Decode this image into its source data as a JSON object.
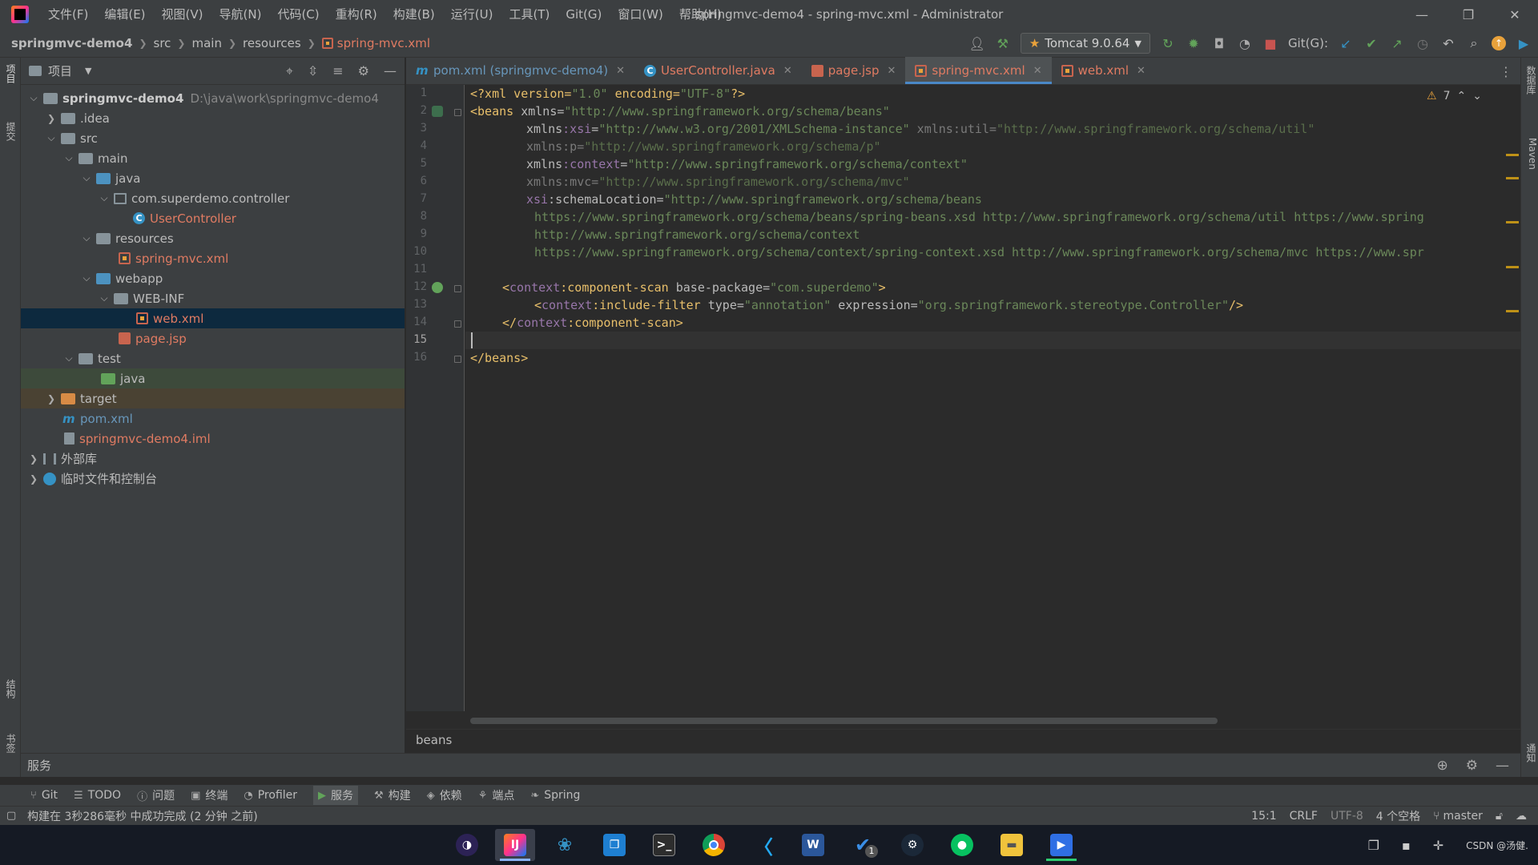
{
  "window": {
    "title": "springmvc-demo4 - spring-mvc.xml - Administrator",
    "menu": [
      "文件(F)",
      "编辑(E)",
      "视图(V)",
      "导航(N)",
      "代码(C)",
      "重构(R)",
      "构建(B)",
      "运行(U)",
      "工具(T)",
      "Git(G)",
      "窗口(W)",
      "帮助(H)"
    ]
  },
  "breadcrumbs": [
    "springmvc-demo4",
    "src",
    "main",
    "resources",
    "spring-mvc.xml"
  ],
  "toolbar": {
    "run_config": "Tomcat 9.0.64",
    "git_label": "Git(G):"
  },
  "left_strip": {
    "top_tab": "项目",
    "commit_tab": "提交",
    "structure_tab": "结构",
    "bookmarks_tab": "书签"
  },
  "right_strip": {
    "db_tab": "数据库",
    "maven_tab": "Maven",
    "notify_tab": "通知"
  },
  "project_panel": {
    "title": "项目",
    "tree": [
      {
        "label": "springmvc-demo4",
        "path": "D:\\java\\work\\springmvc-demo4"
      },
      {
        "label": ".idea"
      },
      {
        "label": "src"
      },
      {
        "label": "main"
      },
      {
        "label": "java"
      },
      {
        "label": "com.superdemo.controller"
      },
      {
        "label": "UserController"
      },
      {
        "label": "resources"
      },
      {
        "label": "spring-mvc.xml"
      },
      {
        "label": "webapp"
      },
      {
        "label": "WEB-INF"
      },
      {
        "label": "web.xml"
      },
      {
        "label": "page.jsp"
      },
      {
        "label": "test"
      },
      {
        "label": "java"
      },
      {
        "label": "target"
      },
      {
        "label": "pom.xml"
      },
      {
        "label": "springmvc-demo4.iml"
      },
      {
        "label": "外部库"
      },
      {
        "label": "临时文件和控制台"
      }
    ]
  },
  "tabs": [
    {
      "label": "pom.xml (springmvc-demo4)"
    },
    {
      "label": "UserController.java"
    },
    {
      "label": "page.jsp"
    },
    {
      "label": "spring-mvc.xml"
    },
    {
      "label": "web.xml"
    }
  ],
  "editor": {
    "warnings": "7",
    "line_numbers": [
      "1",
      "2",
      "3",
      "4",
      "5",
      "6",
      "7",
      "8",
      "9",
      "10",
      "11",
      "12",
      "13",
      "14",
      "15",
      "16"
    ],
    "breadcrumb": "beans"
  },
  "code": {
    "l1": {
      "a": "<?xml version=",
      "b": "\"1.0\"",
      "c": " encoding=",
      "d": "\"UTF-8\"",
      "e": "?>"
    },
    "l2": {
      "a": "<beans ",
      "b": "xmlns",
      "c": "=",
      "d": "\"http://www.springframework.org/schema/beans\""
    },
    "l3": {
      "a": "xmlns",
      "b": ":xsi",
      "c": "=",
      "d": "\"http://www.w3.org/2001/XMLSchema-instance\"",
      "e": " xmlns:util=",
      "f": "\"http://www.springframework.org/schema/util\""
    },
    "l4": {
      "a": "xmlns:p=",
      "b": "\"http://www.springframework.org/schema/p\""
    },
    "l5": {
      "a": "xmlns",
      "b": ":context",
      "c": "=",
      "d": "\"http://www.springframework.org/schema/context\""
    },
    "l6": {
      "a": "xmlns:mvc=",
      "b": "\"http://www.springframework.org/schema/mvc\""
    },
    "l7": {
      "a": "xsi",
      "b": ":schemaLocation=",
      "c": "\"http://www.springframework.org/schema/beans"
    },
    "l8": {
      "a": "https://www.springframework.org/schema/beans/spring-beans.xsd http://www.springframework.org/schema/util https://www.spring"
    },
    "l9": {
      "a": "http://www.springframework.org/schema/context"
    },
    "l10": {
      "a": "https://www.springframework.org/schema/context/spring-context.xsd http://www.springframework.org/schema/mvc https://www.spr"
    },
    "l12": {
      "a": "<",
      "b": "context",
      "c": ":component-scan ",
      "d": "base-package=",
      "e": "\"com.superdemo\"",
      "f": ">"
    },
    "l13": {
      "a": "<",
      "b": "context",
      "c": ":include-filter ",
      "d": "type=",
      "e": "\"annotation\"",
      "f": " expression=",
      "g": "\"org.springframework.stereotype.Controller\"",
      "h": "/>"
    },
    "l14": {
      "a": "</",
      "b": "context",
      "c": ":component-scan>"
    },
    "l16": {
      "a": "</beans>"
    }
  },
  "services": {
    "label": "服务"
  },
  "bottom_tabs": [
    "Git",
    "TODO",
    "问题",
    "终端",
    "Profiler",
    "服务",
    "构建",
    "依赖",
    "端点",
    "Spring"
  ],
  "status": {
    "message": "构建在 3秒286毫秒 中成功完成 (2 分钟 之前)",
    "position": "15:1",
    "line_sep": "CRLF",
    "encoding": "UTF-8",
    "indent": "4 个空格",
    "branch": "master"
  },
  "taskbar": {
    "watermark": "CSDN @汤健.",
    "badge": "1"
  },
  "colors": {
    "accent": "#4a88c7",
    "xml_tag": "#e8bf6a",
    "xml_value": "#6a8759",
    "namespace": "#9876aa",
    "modified_file": "#e07b62"
  }
}
